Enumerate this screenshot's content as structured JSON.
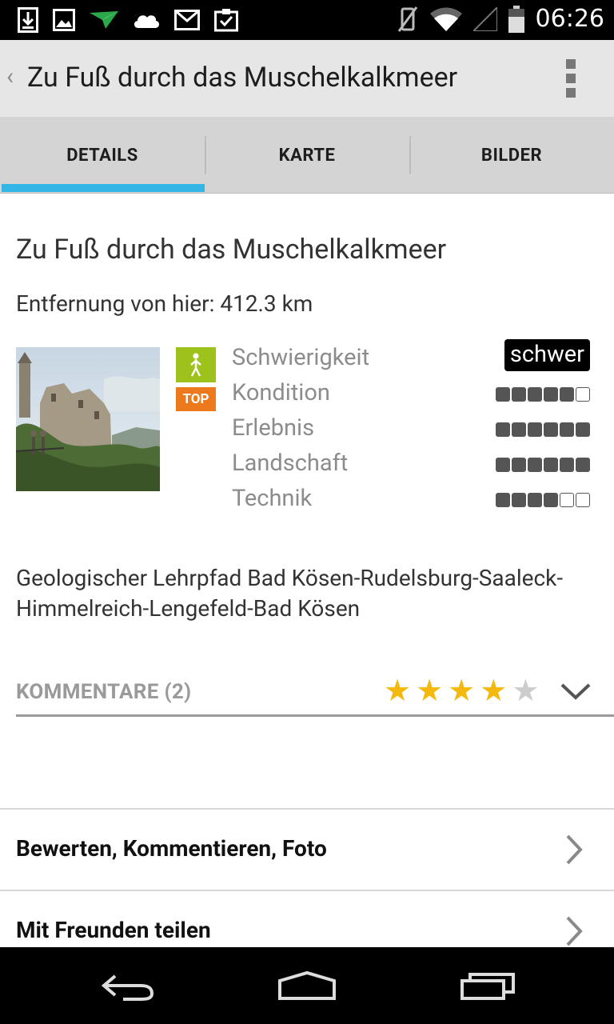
{
  "status_bar": {
    "time": "06:26",
    "left_icons": [
      "download-icon",
      "image-icon",
      "navigation-arrow-icon",
      "cloud-icon",
      "gmail-icon",
      "clipboard-check-icon"
    ],
    "right_icons": [
      "vibrate-muted-icon",
      "wifi-icon",
      "signal-icon",
      "battery-icon"
    ]
  },
  "action_bar": {
    "back_glyph": "‹",
    "title": "Zu Fuß durch das Muschelkalkmeer",
    "menu_icon": "overflow-menu-icon"
  },
  "tabs": [
    {
      "label": "DETAILS",
      "selected": true
    },
    {
      "label": "KARTE",
      "selected": false
    },
    {
      "label": "BILDER",
      "selected": false
    }
  ],
  "accent_color": "#33b5e5",
  "tour": {
    "title": "Zu Fuß durch das Muschelkalkmeer",
    "distance": "Entfernung von hier: 412.3 km",
    "photo": "castle-photo",
    "badge_walk_icon": "hiker-icon",
    "badge_walk_color": "#9dc21c",
    "badge_top_label": "TOP",
    "badge_top_color": "#ec7a1c",
    "difficulty": {
      "label": "Schwierigkeit",
      "value": "schwer"
    },
    "ratings": [
      {
        "label": "Kondition",
        "filled": 5,
        "total": 6
      },
      {
        "label": "Erlebnis",
        "filled": 6,
        "total": 6
      },
      {
        "label": "Landschaft",
        "filled": 6,
        "total": 6
      },
      {
        "label": "Technik",
        "filled": 4,
        "total": 6
      }
    ],
    "description": "Geologischer Lehrpfad Bad Kösen-Rudelsburg-Saaleck-Himmelreich-Lengefeld-Bad Kösen"
  },
  "comments": {
    "label": "KOMMENTARE (2)",
    "stars": 4,
    "stars_total": 5,
    "star_color": "#f5b80f",
    "expand_icon": "chevron-down-icon"
  },
  "actions": [
    {
      "label": "Bewerten, Kommentieren, Foto",
      "icon": "chevron-right-icon"
    },
    {
      "label": "Mit Freunden teilen",
      "icon": "chevron-right-icon"
    }
  ],
  "nav_bar": [
    "back-nav-icon",
    "home-nav-icon",
    "recents-nav-icon"
  ]
}
